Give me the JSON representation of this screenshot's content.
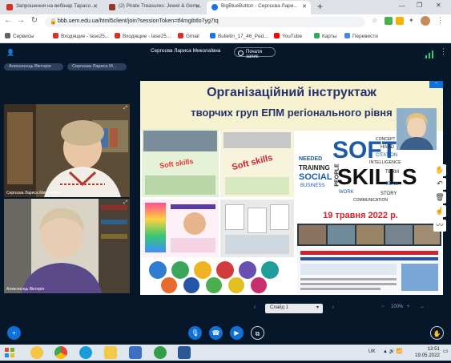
{
  "browser": {
    "tabs": [
      {
        "label": "Запрошення на вебінар Тарасо...",
        "color": "#d93025"
      },
      {
        "label": "(2) Pirate Treasures: Jewel & Gem...",
        "color": "#8b3a2c"
      },
      {
        "label": "BigBlueButton - Сергєєва Лари...",
        "color": "#1a73e8"
      }
    ],
    "url": "bbb.uem.edu.ua/html5client/join?sessionToken=tf4mgibtlo7yg7tq",
    "bookmarks": [
      {
        "label": "Сервисы",
        "color": "#5f6368"
      },
      {
        "label": "Входящие - lase25...",
        "color": "#d93025"
      },
      {
        "label": "Входящие - lase25...",
        "color": "#d93025"
      },
      {
        "label": "Gmail",
        "color": "#d93025"
      },
      {
        "label": "Bulletin_17_46_Ped...",
        "color": "#1a73e8"
      },
      {
        "label": "YouTube",
        "color": "#ff0000"
      },
      {
        "label": "Карты",
        "color": "#34a853"
      },
      {
        "label": "Перевести",
        "color": "#4285f4"
      }
    ]
  },
  "meeting": {
    "presenter": "Сергєєва Лариса Миколаївна",
    "record_label": "Почати запис",
    "participants": [
      "Алексеєнць Вікторія",
      "Сергєєва Лариса М..."
    ],
    "videos": [
      {
        "name": "Сергєєва Лариса Миколаївна"
      },
      {
        "name": "Алексеєнць Вікторія"
      }
    ]
  },
  "slide": {
    "title_line1": "Організаційний  інструктаж",
    "title_line2": "творчих груп ЕПМ регіонального рівня",
    "date_text": "19 травня 2022 р.",
    "soft_skills_label": "Soft skills",
    "soft": "SOFT",
    "skills": "SKILLS",
    "word_cloud": [
      "TRAINING",
      "SOCIAL",
      "NEEDED",
      "HARD",
      "CITATION",
      "INTELLIGENCE",
      "TERM",
      "PEOPLE",
      "WORK",
      "TEAM",
      "COMMUNICATION",
      "STORY",
      "BUSINESS",
      "CONCEPT"
    ],
    "controls_label": "Слайд 1",
    "zoom_value": "100%"
  },
  "taskbar": {
    "lang": "UK",
    "time": "13:51",
    "date": "19.05.2022"
  },
  "colors": {
    "bbb_bg": "#06172a",
    "bbb_blue": "#0f70d7",
    "slide_title": "#25336d",
    "date_red": "#d2232a"
  }
}
